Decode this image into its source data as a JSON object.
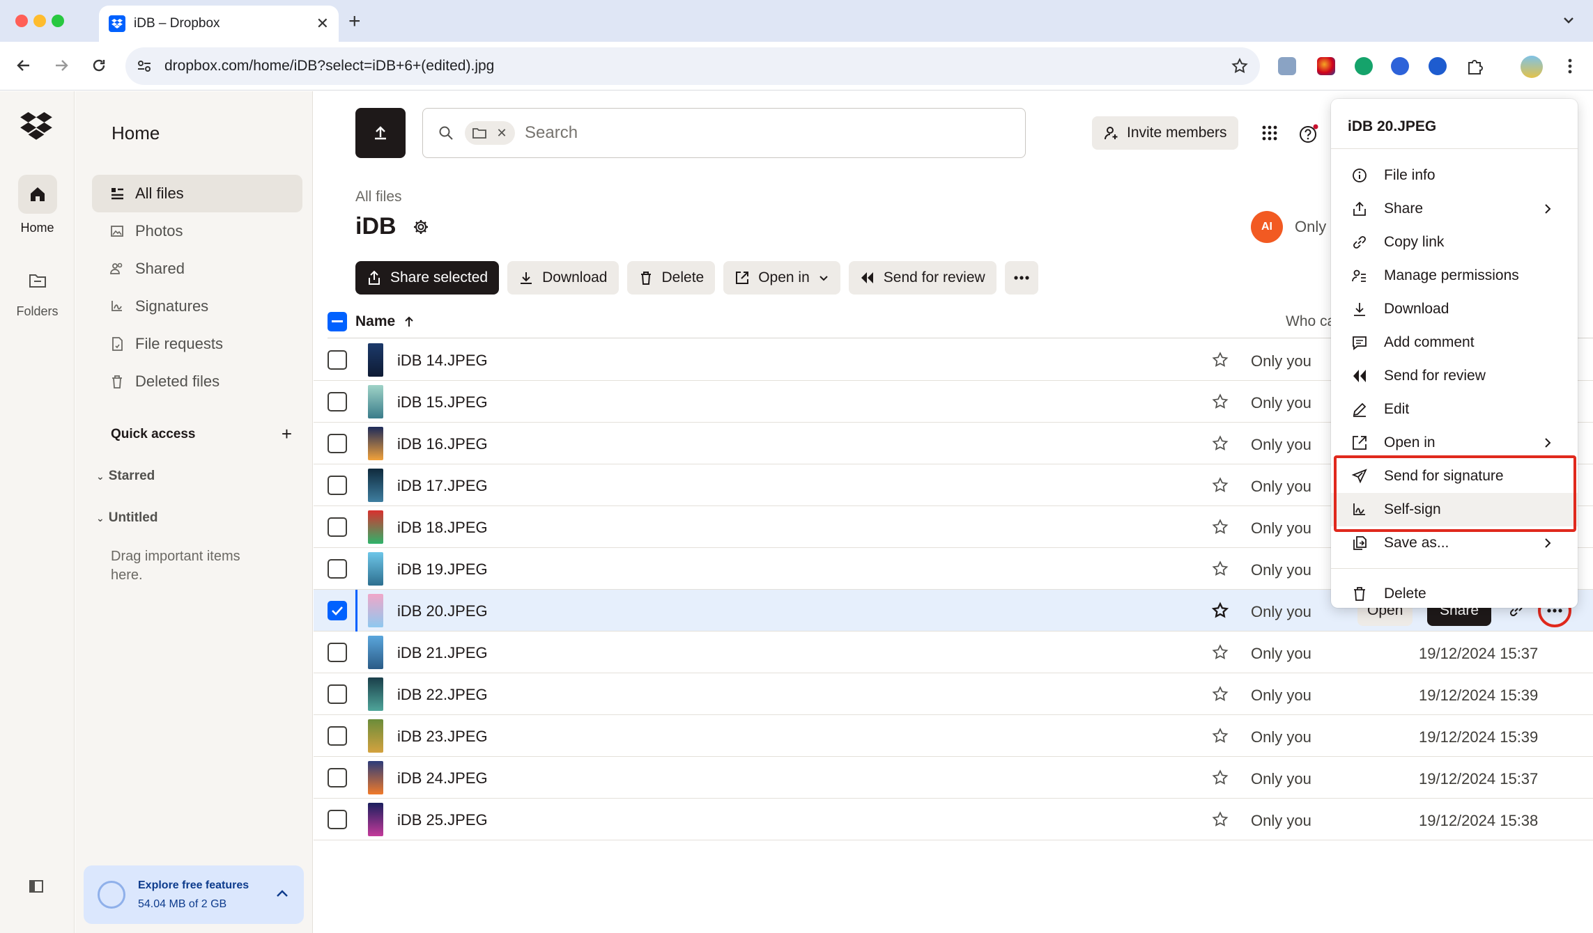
{
  "browser": {
    "tab_title": "iDB – Dropbox",
    "url": "dropbox.com/home/iDB?select=iDB+6+(edited).jpg"
  },
  "rail": {
    "home_label": "Home",
    "folders_label": "Folders"
  },
  "sidebar": {
    "title": "Home",
    "items": [
      {
        "label": "All files",
        "icon": "all-files-icon"
      },
      {
        "label": "Photos",
        "icon": "photos-icon"
      },
      {
        "label": "Shared",
        "icon": "shared-icon"
      },
      {
        "label": "Signatures",
        "icon": "signatures-icon"
      },
      {
        "label": "File requests",
        "icon": "file-requests-icon"
      },
      {
        "label": "Deleted files",
        "icon": "deleted-files-icon"
      }
    ],
    "quick_access": "Quick access",
    "starred": "Starred",
    "untitled": "Untitled",
    "drag_hint": "Drag important items here.",
    "explore_title": "Explore free features",
    "explore_usage": "54.04 MB of 2 GB"
  },
  "topbar": {
    "search_placeholder": "Search",
    "invite_label": "Invite members"
  },
  "folder": {
    "breadcrumb": "All files",
    "title": "iDB",
    "avatar_initials": "AI",
    "sharing_summary": "Only"
  },
  "actions": {
    "share_selected": "Share selected",
    "download": "Download",
    "delete": "Delete",
    "open_in": "Open in",
    "send_for_review": "Send for review"
  },
  "table": {
    "col_name": "Name",
    "col_who": "Who can ac",
    "rows": [
      {
        "name": "iDB 14.JPEG",
        "who": "Only you",
        "modified": "",
        "thumb": [
          "#1c3a6b",
          "#0e1a33"
        ]
      },
      {
        "name": "iDB 15.JPEG",
        "who": "Only you",
        "modified": "",
        "thumb": [
          "#9fd3c7",
          "#3a7c8a"
        ]
      },
      {
        "name": "iDB 16.JPEG",
        "who": "Only you",
        "modified": "",
        "thumb": [
          "#1d2b5a",
          "#f2a23a"
        ]
      },
      {
        "name": "iDB 17.JPEG",
        "who": "Only you",
        "modified": "",
        "thumb": [
          "#0f2a3d",
          "#3e7ea0"
        ]
      },
      {
        "name": "iDB 18.JPEG",
        "who": "Only you",
        "modified": "",
        "thumb": [
          "#d8312f",
          "#2fb36a"
        ]
      },
      {
        "name": "iDB 19.JPEG",
        "who": "Only you",
        "modified": "",
        "thumb": [
          "#6ec6e8",
          "#2d6f8f"
        ]
      },
      {
        "name": "iDB 20.JPEG",
        "who": "Only you",
        "modified": "",
        "thumb": [
          "#f0a6c8",
          "#8ec8ef"
        ],
        "selected": true,
        "open_label": "Open",
        "share_label": "Share"
      },
      {
        "name": "iDB 21.JPEG",
        "who": "Only you",
        "modified": "19/12/2024 15:37",
        "thumb": [
          "#5aa6dc",
          "#2b5b86"
        ]
      },
      {
        "name": "iDB 22.JPEG",
        "who": "Only you",
        "modified": "19/12/2024 15:39",
        "thumb": [
          "#1a3f4a",
          "#4fa59a"
        ]
      },
      {
        "name": "iDB 23.JPEG",
        "who": "Only you",
        "modified": "19/12/2024 15:39",
        "thumb": [
          "#6b8c3a",
          "#d4a23f"
        ]
      },
      {
        "name": "iDB 24.JPEG",
        "who": "Only you",
        "modified": "19/12/2024 15:37",
        "thumb": [
          "#2c3c7a",
          "#f07a2a"
        ]
      },
      {
        "name": "iDB 25.JPEG",
        "who": "Only you",
        "modified": "19/12/2024 15:38",
        "thumb": [
          "#1b1f5e",
          "#c43a9a"
        ]
      }
    ]
  },
  "context_menu": {
    "title": "iDB 20.JPEG",
    "items": [
      {
        "label": "File info",
        "icon": "info-icon"
      },
      {
        "label": "Share",
        "icon": "share-icon",
        "submenu": true
      },
      {
        "label": "Copy link",
        "icon": "link-icon"
      },
      {
        "label": "Manage permissions",
        "icon": "permissions-icon"
      },
      {
        "label": "Download",
        "icon": "download-icon"
      },
      {
        "label": "Add comment",
        "icon": "comment-icon"
      },
      {
        "label": "Send for review",
        "icon": "review-icon"
      },
      {
        "label": "Edit",
        "icon": "edit-icon"
      },
      {
        "label": "Open in",
        "icon": "open-in-icon",
        "submenu": true
      },
      {
        "label": "Send for signature",
        "icon": "send-signature-icon"
      },
      {
        "label": "Self-sign",
        "icon": "self-sign-icon"
      },
      {
        "label": "Save as...",
        "icon": "save-as-icon",
        "submenu": true
      },
      {
        "label": "Delete",
        "icon": "delete-icon"
      }
    ]
  },
  "colors": {
    "accent": "#0061fe",
    "highlight": "#e0291d",
    "dark_button": "#1e1919"
  }
}
